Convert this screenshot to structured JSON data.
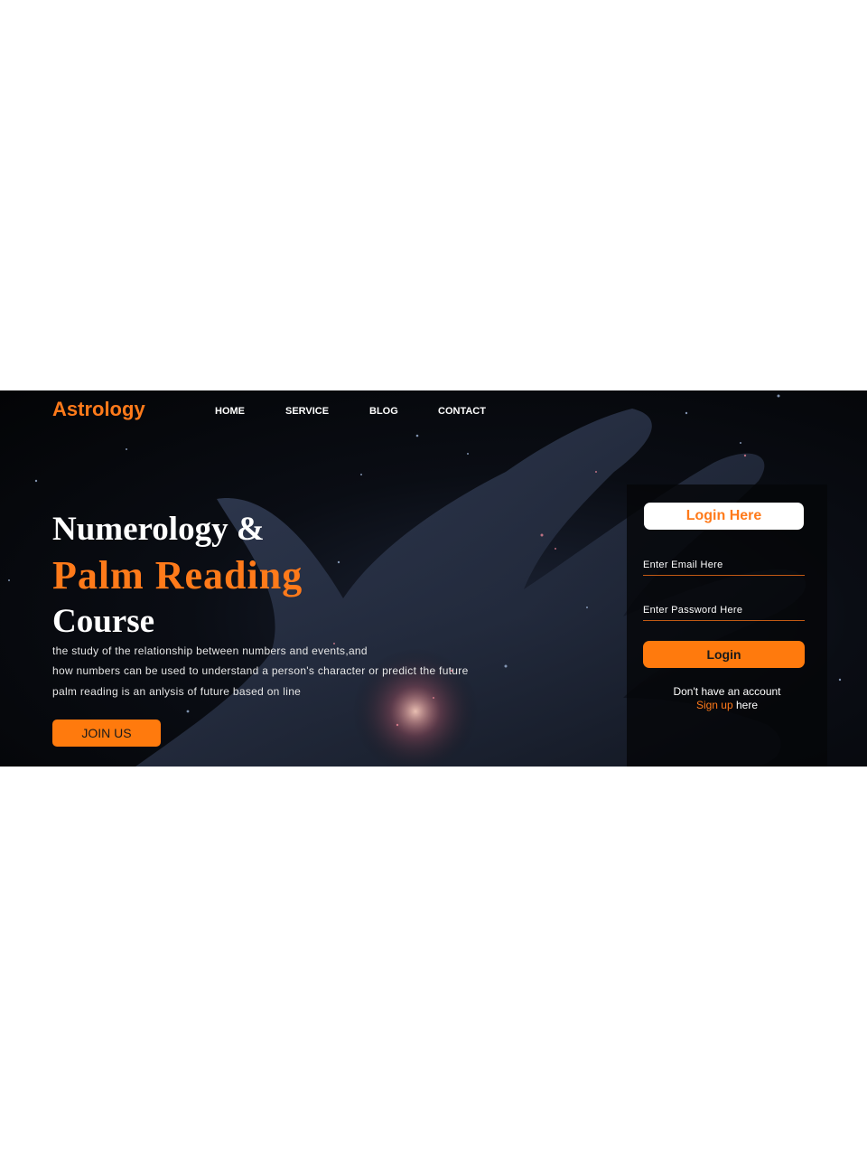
{
  "brand": {
    "logo": "Astrology"
  },
  "nav": {
    "items": [
      "HOME",
      "SERVICE",
      "BLOG",
      "CONTACT"
    ]
  },
  "hero": {
    "title_line1": "Numerology &",
    "title_line2": "Palm Reading",
    "title_line3": "Course",
    "description": [
      "the study of the relationship between numbers and events,and",
      "how numbers can be used to understand a person's character or predict the future",
      "palm reading is an anlysis of future based on line"
    ],
    "cta_label": "JOIN US"
  },
  "login": {
    "header": "Login Here",
    "email_placeholder": "Enter Email Here",
    "password_placeholder": "Enter Password Here",
    "submit_label": "Login",
    "signup_prompt": "Don't have an account",
    "signup_link": "Sign up",
    "signup_suffix": "here"
  },
  "colors": {
    "accent": "#ff7a1a",
    "background": "#05070b",
    "text": "#ffffff"
  }
}
